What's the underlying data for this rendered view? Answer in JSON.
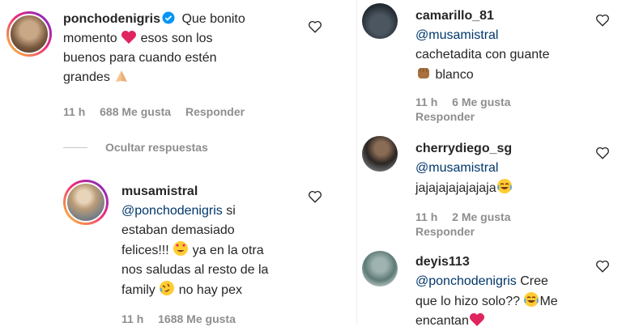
{
  "left": {
    "c1": {
      "username": "ponchodenigris",
      "text_a": "Que bonito",
      "text_b": "momento",
      "text_c": "esos son los",
      "text_d": "buenos para cuando estén",
      "text_e": "grandes",
      "time": "11 h",
      "likes": "688 Me gusta",
      "reply": "Responder"
    },
    "hide_replies": "Ocultar respuestas",
    "c2": {
      "username": "musamistral",
      "mention": "@ponchodenigris",
      "text_a": "si",
      "text_b": "estaban demasiado",
      "text_c": "felices!!!",
      "text_d": "ya en la otra",
      "text_e": "nos saludas al resto de la",
      "text_f": "family",
      "text_g": "no hay pex",
      "time": "11 h",
      "likes": "1688 Me gusta"
    }
  },
  "right": {
    "c1": {
      "username": "camarillo_81",
      "mention": "@musamistral",
      "text_a": "cachetadita con guante",
      "text_b": "blanco",
      "time": "11 h",
      "likes": "6 Me gusta",
      "reply": "Responder"
    },
    "c2": {
      "username": "cherrydiego_sg",
      "mention": "@musamistral",
      "text_a": "jajajajajajajaja",
      "time": "11 h",
      "likes": "2 Me gusta",
      "reply": "Responder"
    },
    "c3": {
      "username": "deyis113",
      "mention": "@ponchodenigris",
      "text_a": "Cree",
      "text_b": "que lo hizo solo??",
      "text_c": "Me",
      "text_d": "encantan"
    }
  },
  "icons": [
    "heart-outline-icon",
    "verified-badge-icon",
    "red-heart-emoji",
    "praying-hands-emoji",
    "heart-eyes-emoji",
    "rofl-emoji",
    "joy-emoji",
    "fist-emoji"
  ],
  "colors": {
    "mention": "#00376b",
    "meta": "#8e8e8e",
    "verified": "#0095f6",
    "red_heart": "#e0245e"
  }
}
